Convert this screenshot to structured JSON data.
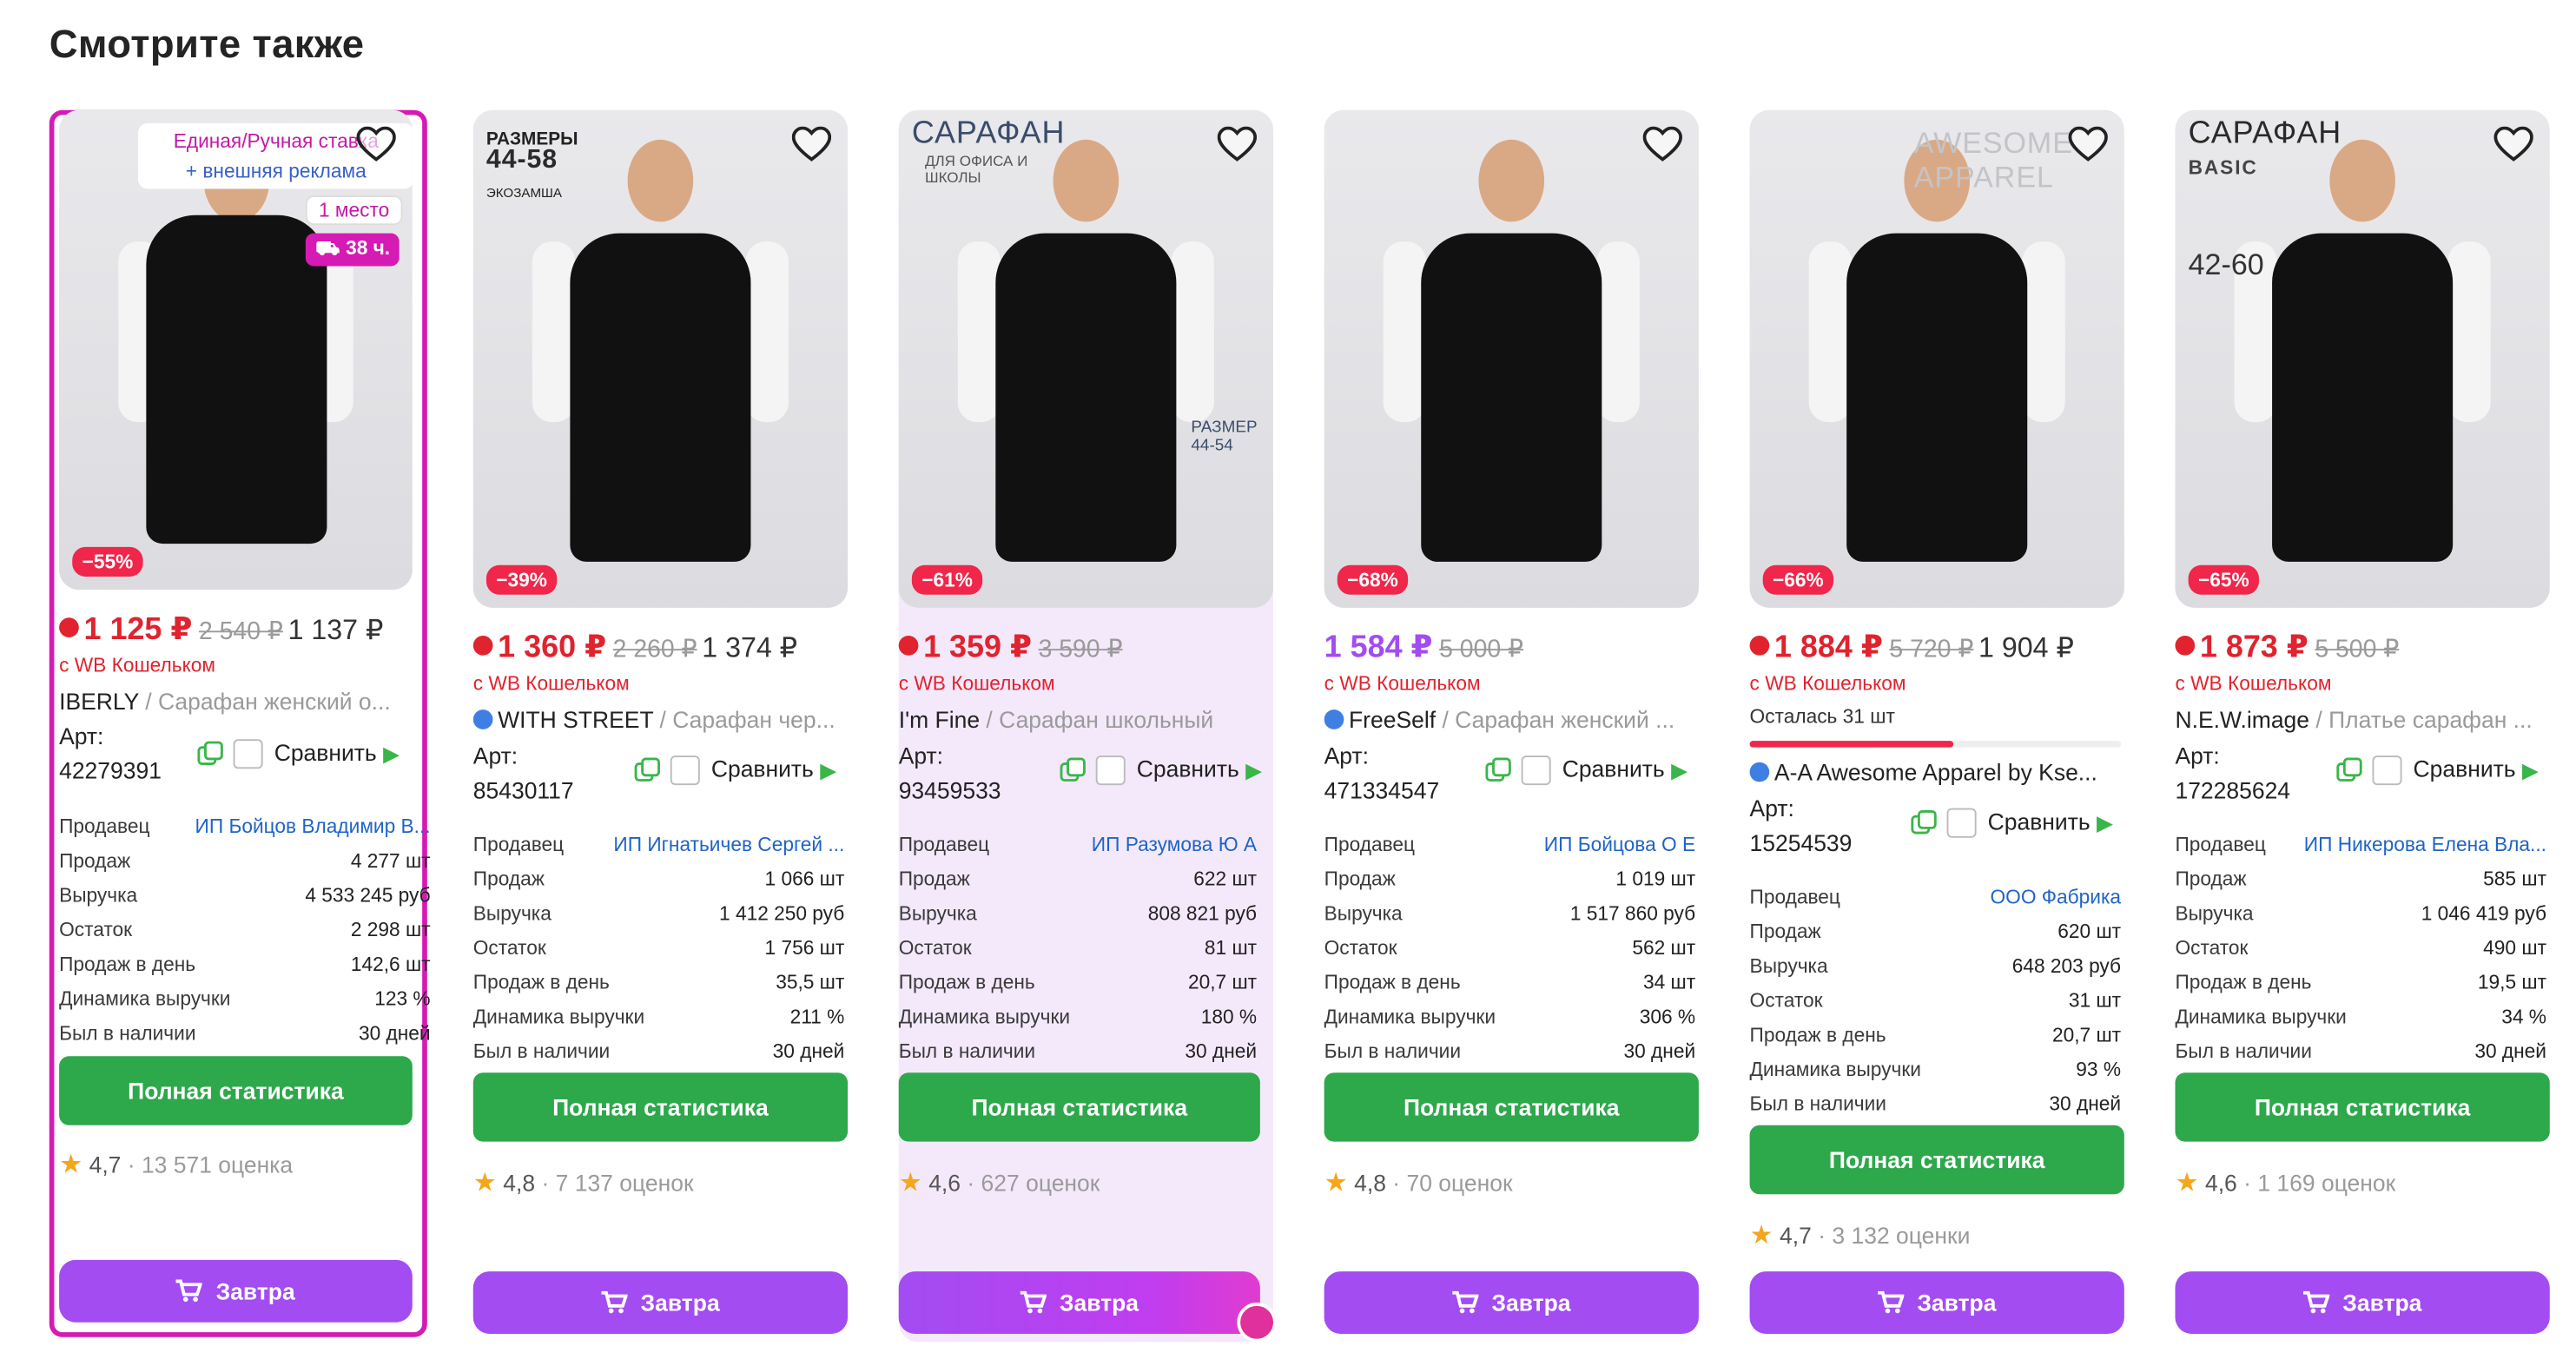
{
  "section_title": "Смотрите также",
  "labels": {
    "art": "Арт:",
    "compare": "Сравнить",
    "stats_button": "Полная статистика",
    "cart_button": "Завтра",
    "wallet_note": "с WB Кошельком"
  },
  "stat_keys": {
    "seller": "Продавец",
    "sales": "Продаж",
    "revenue": "Выручка",
    "stock": "Остаток",
    "per_day": "Продаж в день",
    "dynamics": "Динамика выручки",
    "in_stock": "Был в наличии"
  },
  "colors": {
    "red": "#e0232e",
    "purple": "#a24cf2",
    "green": "#2da84b",
    "ad_border": "#d61ab4",
    "seller_link": "#1f64c7"
  },
  "cards": [
    {
      "ad_line1": "Единая/Ручная ставка",
      "ad_line2": "+ внешняя реклама",
      "place": "1 место",
      "time": "38 ч.",
      "discount": "−55%",
      "price": "1 125 ₽",
      "old_price": "2 540 ₽",
      "extra_price": "1 137 ₽",
      "brand": "IBERLY",
      "name": " / Сарафан женский о...",
      "art": "42279391",
      "seller": "ИП Бойцов Владимир В...",
      "sales": "4 277 шт",
      "revenue": "4 533 245 руб",
      "stock": "2 298 шт",
      "per_day": "142,6 шт",
      "dynamics": "123 %",
      "in_stock": "30 дней",
      "rating": "4,7",
      "reviews": "· 13 571 оценка"
    },
    {
      "overlay1": "РАЗМЕРЫ",
      "overlay2": "44-58",
      "overlay3": "ЭКОЗАМША",
      "discount": "−39%",
      "price": "1 360 ₽",
      "old_price": "2 260 ₽",
      "extra_price": "1 374 ₽",
      "brand": "WITH STREET",
      "name": " / Сарафан чер...",
      "art": "85430117",
      "seller": "ИП Игнатьичев Сергей ...",
      "sales": "1 066 шт",
      "revenue": "1 412 250 руб",
      "stock": "1 756 шт",
      "per_day": "35,5 шт",
      "dynamics": "211 %",
      "in_stock": "30 дней",
      "rating": "4,8",
      "reviews": "· 7 137 оценок"
    },
    {
      "overlay1": "САРАФАН",
      "overlay2": "ДЛЯ ОФИСА И ШКОЛЫ",
      "overlay3": "РАЗМЕР 44-54",
      "discount": "−61%",
      "price": "1 359 ₽",
      "old_price": "3 590 ₽",
      "brand": "I'm Fine",
      "name": " / Сарафан школьный",
      "art": "93459533",
      "seller": "ИП Разумова Ю А",
      "sales": "622 шт",
      "revenue": "808 821 руб",
      "stock": "81 шт",
      "per_day": "20,7 шт",
      "dynamics": "180 %",
      "in_stock": "30 дней",
      "rating": "4,6",
      "reviews": "· 627 оценок"
    },
    {
      "discount": "−68%",
      "price": "1 584 ₽",
      "old_price": "5 000 ₽",
      "brand": "FreeSelf",
      "name": " / Сарафан женский ...",
      "art": "471334547",
      "seller": "ИП Бойцова О Е",
      "sales": "1 019 шт",
      "revenue": "1 517 860 руб",
      "stock": "562 шт",
      "per_day": "34 шт",
      "dynamics": "306 %",
      "in_stock": "30 дней",
      "rating": "4,8",
      "reviews": "· 70 оценок"
    },
    {
      "overlay1": "AWESOME APPAREL",
      "discount": "−66%",
      "price": "1 884 ₽",
      "old_price": "5 720 ₽",
      "extra_price": "1 904 ₽",
      "stock_left": "Осталась 31 шт",
      "stock_left_fraction": 0.55,
      "brand": "A-A Awesome Apparel by Kse...",
      "name": "",
      "art": "15254539",
      "seller": "ООО Фабрика",
      "sales": "620 шт",
      "revenue": "648 203 руб",
      "stock": "31 шт",
      "per_day": "20,7 шт",
      "dynamics": "93 %",
      "in_stock": "30 дней",
      "rating": "4,7",
      "reviews": "· 3 132 оценки"
    },
    {
      "overlay1": "САРАФАН",
      "overlay2": "BASIC",
      "overlay3": "42-60",
      "discount": "−65%",
      "price": "1 873 ₽",
      "old_price": "5 500 ₽",
      "brand": "N.E.W.image",
      "name": " / Платье сарафан ...",
      "art": "172285624",
      "seller": "ИП Никерова Елена Вла...",
      "sales": "585 шт",
      "revenue": "1 046 419 руб",
      "stock": "490 шт",
      "per_day": "19,5 шт",
      "dynamics": "34 %",
      "in_stock": "30 дней",
      "rating": "4,6",
      "reviews": "· 1 169 оценок"
    }
  ]
}
